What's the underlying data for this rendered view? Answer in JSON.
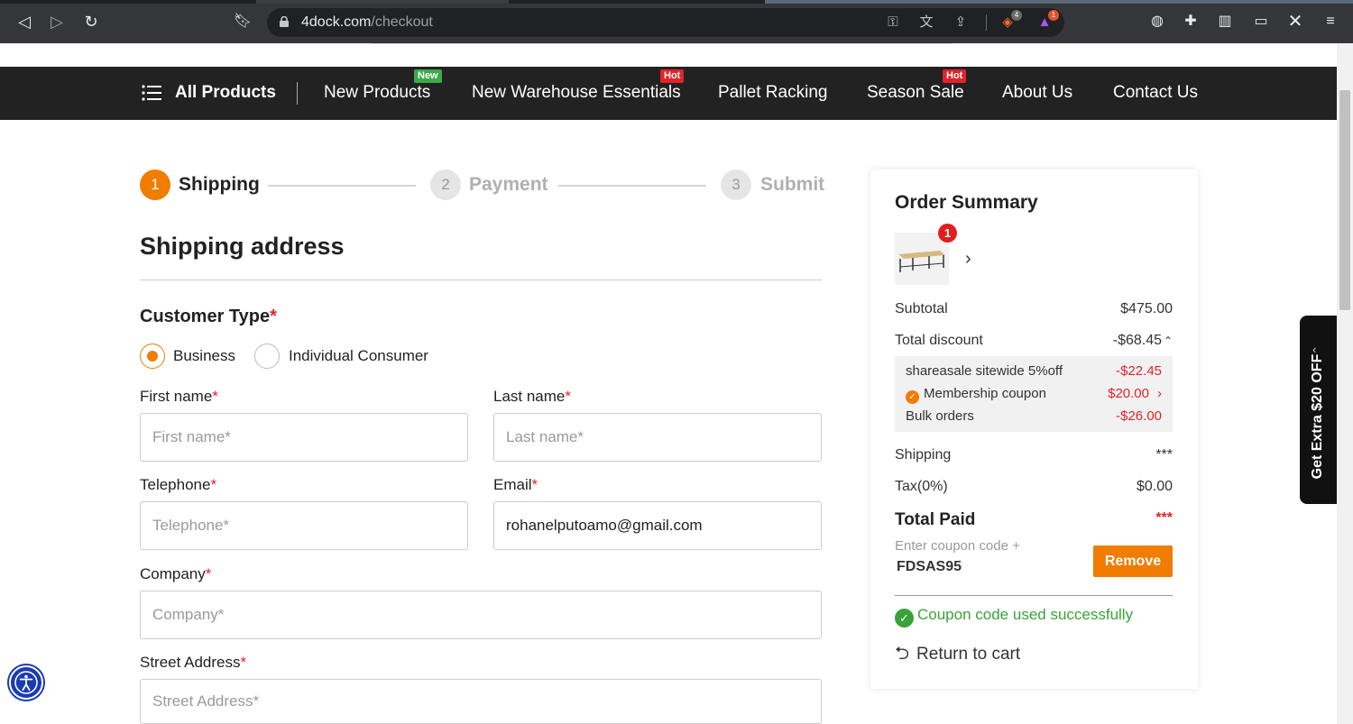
{
  "browser": {
    "url_host": "4dock.com",
    "url_path": "/checkout",
    "ext_badges": {
      "brave": "4",
      "alert": "1"
    }
  },
  "nav": {
    "all_products": "All Products",
    "items": [
      {
        "label": "New Products",
        "tag": "New",
        "tag_color": "#3daa4a"
      },
      {
        "label": "New Warehouse Essentials",
        "tag": "Hot",
        "tag_color": "#e0242a"
      },
      {
        "label": "Pallet Racking",
        "tag": ""
      },
      {
        "label": "Season Sale",
        "tag": "Hot",
        "tag_color": "#e0242a"
      },
      {
        "label": "About Us",
        "tag": ""
      },
      {
        "label": "Contact Us",
        "tag": ""
      }
    ]
  },
  "steps": [
    {
      "number": "1",
      "label": "Shipping",
      "active": true
    },
    {
      "number": "2",
      "label": "Payment",
      "active": false
    },
    {
      "number": "3",
      "label": "Submit",
      "active": false
    }
  ],
  "form": {
    "title": "Shipping address",
    "customer_type": "Customer Type",
    "required_mark": "*",
    "radio_business": "Business",
    "radio_individual": "Individual Consumer",
    "first_name_label": "First name",
    "first_name_placeholder": "First name*",
    "last_name_label": "Last name",
    "last_name_placeholder": "Last name*",
    "telephone_label": "Telephone",
    "telephone_placeholder": "Telephone*",
    "email_label": "Email",
    "email_value": "rohanelputoamo@gmail.com",
    "company_label": "Company",
    "company_placeholder": "Company*",
    "street_label": "Street Address",
    "street_placeholder": "Street Address*"
  },
  "summary": {
    "title": "Order Summary",
    "item_count": "1",
    "subtotal_label": "Subtotal",
    "subtotal_value": "$475.00",
    "discount_label": "Total discount",
    "discount_value": "-$68.45",
    "discounts": [
      {
        "label": "shareasale sitewide 5%off",
        "value": "-$22.45"
      },
      {
        "label": "Membership coupon",
        "value": "$20.00"
      },
      {
        "label": "Bulk orders",
        "value": "-$26.00"
      }
    ],
    "shipping_label": "Shipping",
    "shipping_value": "***",
    "tax_label": "Tax(0%)",
    "tax_value": "$0.00",
    "total_label": "Total Paid",
    "total_value": "***",
    "coupon_label": "Enter coupon code +",
    "coupon_code": "FDSAS95",
    "remove_label": "Remove",
    "success_text": "Coupon code used successfully",
    "return_label": "Return to cart"
  },
  "side_tab": "Get Extra $20 OFF",
  "colors": {
    "accent": "#f07c00",
    "nav_bg": "#222222",
    "success": "#3aa23a",
    "danger": "#e0242a"
  }
}
